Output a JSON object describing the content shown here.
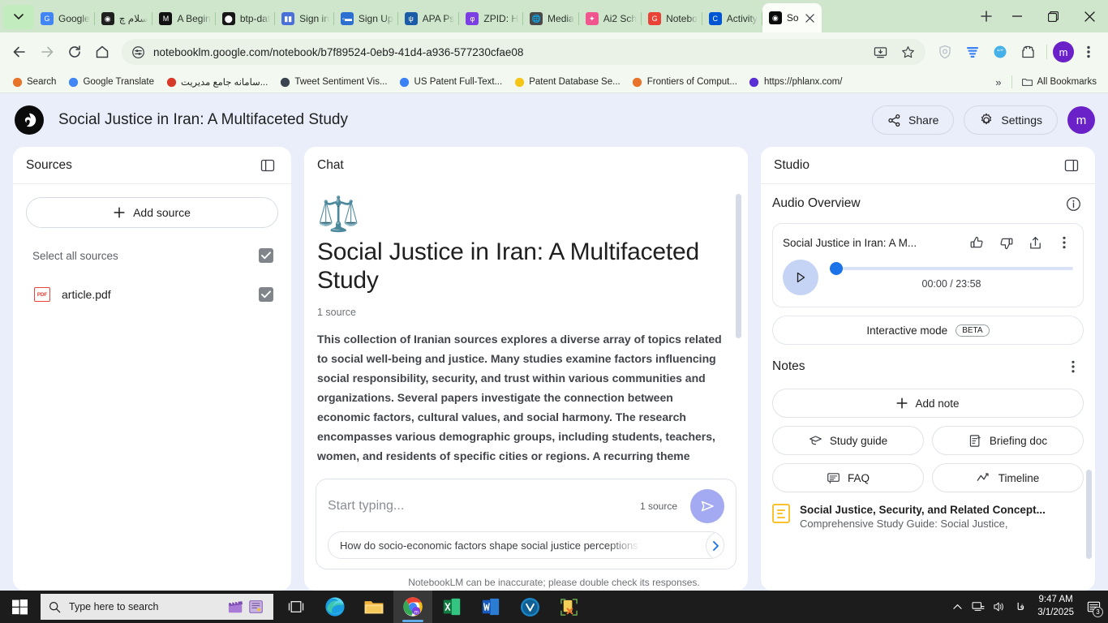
{
  "browser": {
    "tabs": [
      {
        "label": "Google",
        "favicon": "google-translate-icon",
        "color": "#4285f4",
        "glyph": "G"
      },
      {
        "label": "سلام چ",
        "favicon": "dark-circle-icon",
        "color": "#1f1f1f",
        "glyph": "◉"
      },
      {
        "label": "A Begin",
        "favicon": "medium-icon",
        "color": "#111111",
        "glyph": "M"
      },
      {
        "label": "btp-dat",
        "favicon": "github-icon",
        "color": "#181717",
        "glyph": "⬤"
      },
      {
        "label": "Sign in",
        "favicon": "audio-bars-icon",
        "color": "#4b6fd8",
        "glyph": "▮▮"
      },
      {
        "label": "Sign Up",
        "favicon": "orcid-icon",
        "color": "#2c6fd1",
        "glyph": "◦▬"
      },
      {
        "label": "APA Ps",
        "favicon": "apa-icon",
        "color": "#1a5ca8",
        "glyph": "ψ"
      },
      {
        "label": "ZPID: H",
        "favicon": "zpid-icon",
        "color": "#7b3fe4",
        "glyph": "φ"
      },
      {
        "label": "Media",
        "favicon": "globe-icon",
        "color": "#4a4a4a",
        "glyph": "🌐"
      },
      {
        "label": "Ai2 Sch",
        "favicon": "ai2-icon",
        "color": "#f0558d",
        "glyph": "✦"
      },
      {
        "label": "Notebo",
        "favicon": "google-icon",
        "color": "#ea4335",
        "glyph": "G"
      },
      {
        "label": "Activity",
        "favicon": "coursera-icon",
        "color": "#0056d2",
        "glyph": "C"
      },
      {
        "label": "So",
        "favicon": "notebooklm-icon",
        "color": "#0b0b0b",
        "glyph": "◉",
        "active": true
      }
    ],
    "new_tab_label": "+",
    "window_controls": {
      "minimize": "—",
      "maximize": "❐",
      "close": "✕"
    },
    "nav": {
      "back": "back-arrow",
      "forward": "forward-arrow",
      "reload": "reload-icon",
      "home": "home-icon"
    },
    "address": {
      "url": "notebooklm.google.com/notebook/b7f89524-0eb9-41d4-a936-577230cfae08",
      "site_settings_icon": "tune-icon",
      "install_icon": "install-app-icon",
      "bookmark_icon": "star-icon"
    },
    "extensions": [
      {
        "name": "shield-extension-icon",
        "color": "#b8bec9"
      },
      {
        "name": "bars-extension-icon",
        "color": "#3b82f6"
      },
      {
        "name": "quote-extension-icon",
        "color": "#45b1e8"
      },
      {
        "name": "puzzle-extensions-icon",
        "color": "#3c3f45"
      }
    ],
    "profile_initial": "m",
    "menu_icon": "three-dots-vertical-icon",
    "bookmarks": [
      {
        "label": "Search",
        "icon": "e-letter-icon",
        "color": "#e8732a"
      },
      {
        "label": "Google Translate",
        "icon": "google-translate-icon",
        "color": "#4285f4"
      },
      {
        "label": "سامانه جامع مدیریت...",
        "icon": "red-site-icon",
        "color": "#d83a2a"
      },
      {
        "label": "Tweet Sentiment Vis...",
        "icon": "dark-globe-icon",
        "color": "#3b4250"
      },
      {
        "label": "US Patent Full-Text...",
        "icon": "star-badge-icon",
        "color": "#3b82f6"
      },
      {
        "label": "Patent Database Se...",
        "icon": "bulb-icon",
        "color": "#f5c518"
      },
      {
        "label": "Frontiers of Comput...",
        "icon": "frontiers-icon",
        "color": "#e8732a"
      },
      {
        "label": "https://phlanx.com/",
        "icon": "phlanx-icon",
        "color": "#5b2fd6"
      }
    ],
    "bookmarks_overflow": "»",
    "all_bookmarks_label": "All Bookmarks",
    "all_bookmarks_icon": "folder-icon"
  },
  "app": {
    "logo_icon": "notebooklm-logo-icon",
    "title": "Social Justice in Iran: A Multifaceted Study",
    "share_label": "Share",
    "share_icon": "share-icon",
    "settings_label": "Settings",
    "settings_icon": "gear-icon",
    "avatar_initial": "m"
  },
  "sources": {
    "title": "Sources",
    "collapse_icon": "panel-collapse-icon",
    "add_source_label": "Add source",
    "add_icon": "plus-icon",
    "select_all_label": "Select all sources",
    "select_all_checked": true,
    "items": [
      {
        "name": "article.pdf",
        "icon": "pdf-icon",
        "icon_label": "PDF",
        "checked": true
      }
    ]
  },
  "chat": {
    "title": "Chat",
    "hero_emoji": "⚖️",
    "hero_icon": "balance-scale-icon",
    "heading": "Social Justice in Iran: A Multifaceted Study",
    "source_count": "1 source",
    "summary": "This collection of Iranian sources explores a diverse array of topics related to social well-being and justice. Many studies examine factors influencing social responsibility, security, and trust within various communities and organizations. Several papers investigate the connection between economic factors, cultural values, and social harmony. The research encompasses various demographic groups, including students, teachers, women, and residents of specific cities or regions. A recurring theme",
    "input_placeholder": "Start typing...",
    "input_value": "",
    "input_source_count": "1 source",
    "send_icon": "send-icon",
    "suggestion": "How do socio-economic factors shape social justice perceptions?",
    "suggestion_arrow_icon": "chevron-right-icon"
  },
  "studio": {
    "title": "Studio",
    "collapse_icon": "panel-collapse-icon",
    "audio": {
      "section_title": "Audio Overview",
      "info_icon": "info-icon",
      "item_title": "Social Justice in Iran: A M...",
      "thumb_up_icon": "thumb-up-icon",
      "thumb_down_icon": "thumb-down-icon",
      "share_icon": "share-upload-icon",
      "more_icon": "three-dots-vertical-icon",
      "play_icon": "play-icon",
      "time": "00:00 / 23:58",
      "progress_percent": 0,
      "interactive_mode_label": "Interactive mode",
      "beta_badge": "BETA"
    },
    "notes": {
      "section_title": "Notes",
      "more_icon": "three-dots-vertical-icon",
      "add_note_label": "Add note",
      "add_icon": "plus-icon",
      "actions": [
        {
          "label": "Study guide",
          "icon": "graduation-cap-icon"
        },
        {
          "label": "Briefing doc",
          "icon": "briefing-doc-icon"
        },
        {
          "label": "FAQ",
          "icon": "faq-chat-icon"
        },
        {
          "label": "Timeline",
          "icon": "timeline-chart-icon"
        }
      ],
      "items": [
        {
          "icon": "note-doc-icon",
          "title": "Social Justice, Security, and Related Concept...",
          "subtitle": "Comprehensive Study Guide: Social Justice,"
        }
      ]
    }
  },
  "footer": {
    "disclaimer": "NotebookLM can be inaccurate; please double check its responses."
  },
  "taskbar": {
    "start_icon": "windows-start-icon",
    "search_placeholder": "Type here to search",
    "search_icon": "search-icon",
    "search_extra_icons": [
      "clapperboard-icon",
      "news-icon"
    ],
    "apps": [
      {
        "name": "task-view-icon",
        "active": false,
        "running": false
      },
      {
        "name": "microsoft-edge-icon",
        "active": false,
        "running": true
      },
      {
        "name": "file-explorer-icon",
        "active": false,
        "running": true
      },
      {
        "name": "google-chrome-icon",
        "active": true,
        "running": true
      },
      {
        "name": "microsoft-excel-icon",
        "active": false,
        "running": false
      },
      {
        "name": "microsoft-word-icon",
        "active": false,
        "running": true
      },
      {
        "name": "v-app-icon",
        "active": false,
        "running": false
      },
      {
        "name": "yellow-tool-icon",
        "active": false,
        "running": false
      }
    ],
    "tray": {
      "chevron_icon": "chevron-up-icon",
      "network_icon": "network-icon",
      "volume_icon": "volume-icon",
      "language": "فا",
      "time": "9:47 AM",
      "date": "3/1/2025",
      "notification_icon": "notifications-icon",
      "notification_count": "3"
    }
  },
  "colors": {
    "accent_blue": "#1a73e8",
    "send_button": "#a3aaf2",
    "page_bg": "#eaeefb",
    "tabstrip_bg": "#cfe6cd",
    "profile_purple": "#6b21c8",
    "note_yellow": "#f9c22e",
    "pdf_red": "#e8443a"
  }
}
